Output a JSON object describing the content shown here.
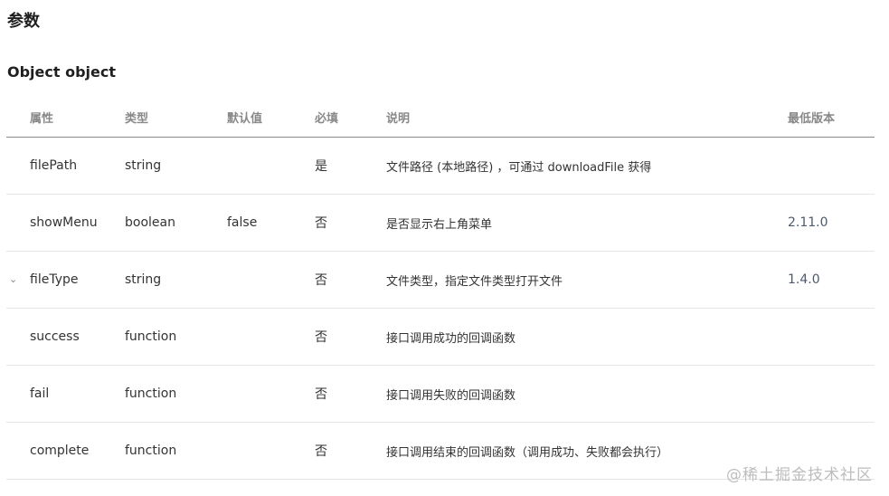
{
  "section_title": "参数",
  "object_title": "Object object",
  "table": {
    "headers": {
      "property": "属性",
      "type": "类型",
      "default": "默认值",
      "required": "必填",
      "description": "说明",
      "min_version": "最低版本"
    },
    "rows": [
      {
        "property": "filePath",
        "type": "string",
        "default": "",
        "required": "是",
        "description": "文件路径 (本地路径) ，可通过 downloadFile 获得",
        "min_version": ""
      },
      {
        "property": "showMenu",
        "type": "boolean",
        "default": "false",
        "required": "否",
        "description": "是否显示右上角菜单",
        "min_version": "2.11.0"
      },
      {
        "property": "fileType",
        "type": "string",
        "default": "",
        "required": "否",
        "description": "文件类型，指定文件类型打开文件",
        "min_version": "1.4.0"
      },
      {
        "property": "success",
        "type": "function",
        "default": "",
        "required": "否",
        "description": "接口调用成功的回调函数",
        "min_version": ""
      },
      {
        "property": "fail",
        "type": "function",
        "default": "",
        "required": "否",
        "description": "接口调用失败的回调函数",
        "min_version": ""
      },
      {
        "property": "complete",
        "type": "function",
        "default": "",
        "required": "否",
        "description": "接口调用结束的回调函数（调用成功、失败都会执行）",
        "min_version": ""
      }
    ]
  },
  "watermark": "@稀土掘金技术社区",
  "icons": {
    "expand": "chevron-down-icon"
  },
  "colors": {
    "header_text": "#888888",
    "version_text": "#4c5a6e",
    "row_border": "#e5e5e5"
  }
}
